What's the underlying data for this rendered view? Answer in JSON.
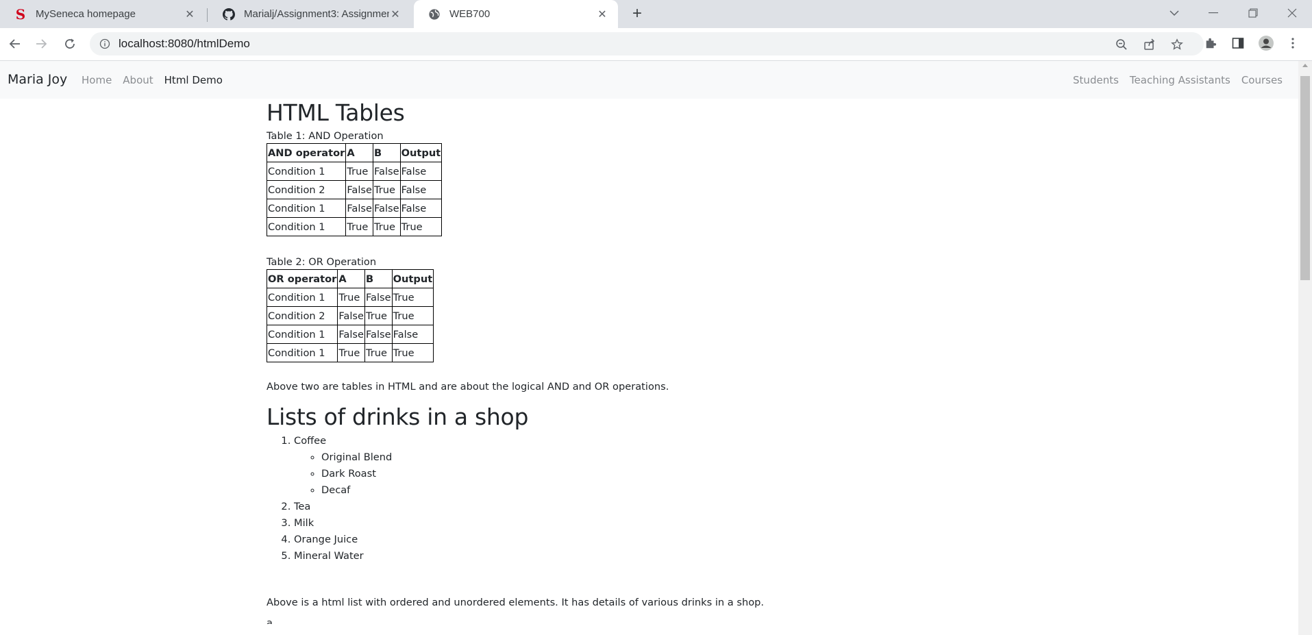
{
  "browser": {
    "tabs": [
      {
        "title": "MySeneca homepage",
        "icon": "seneca-s-icon"
      },
      {
        "title": "Marialj/Assignment3: Assignment",
        "icon": "github-icon"
      },
      {
        "title": "WEB700",
        "icon": "globe-icon"
      }
    ],
    "address": "localhost:8080/htmlDemo"
  },
  "site": {
    "brand": "Maria Joy",
    "nav_left": [
      "Home",
      "About",
      "Html Demo"
    ],
    "nav_right": [
      "Students",
      "Teaching Assistants",
      "Courses"
    ]
  },
  "page": {
    "heading_tables": "HTML Tables",
    "table1": {
      "caption": "Table 1: AND Operation",
      "headers": [
        "AND operator",
        "A",
        "B",
        "Output"
      ],
      "rows": [
        [
          "Condition 1",
          "True",
          "False",
          "False"
        ],
        [
          "Condition 2",
          "False",
          "True",
          "False"
        ],
        [
          "Condition 1",
          "False",
          "False",
          "False"
        ],
        [
          "Condition 1",
          "True",
          "True",
          "True"
        ]
      ]
    },
    "table2": {
      "caption": "Table 2: OR Operation",
      "headers": [
        "OR operator",
        "A",
        "B",
        "Output"
      ],
      "rows": [
        [
          "Condition 1",
          "True",
          "False",
          "True"
        ],
        [
          "Condition 2",
          "False",
          "True",
          "True"
        ],
        [
          "Condition 1",
          "False",
          "False",
          "False"
        ],
        [
          "Condition 1",
          "True",
          "True",
          "True"
        ]
      ]
    },
    "tables_note": "Above two are tables in HTML and are about the logical AND and OR operations.",
    "heading_lists": "Lists of drinks in a shop",
    "drinks": [
      {
        "label": "Coffee",
        "sub": [
          "Original Blend",
          "Dark Roast",
          "Decaf"
        ]
      },
      {
        "label": "Tea",
        "sub": []
      },
      {
        "label": "Milk",
        "sub": []
      },
      {
        "label": "Orange Juice",
        "sub": []
      },
      {
        "label": "Mineral Water",
        "sub": []
      }
    ],
    "list_note": "Above is a html list with ordered and unordered elements. It has details of various drinks in a shop.",
    "cut_text": "a"
  }
}
